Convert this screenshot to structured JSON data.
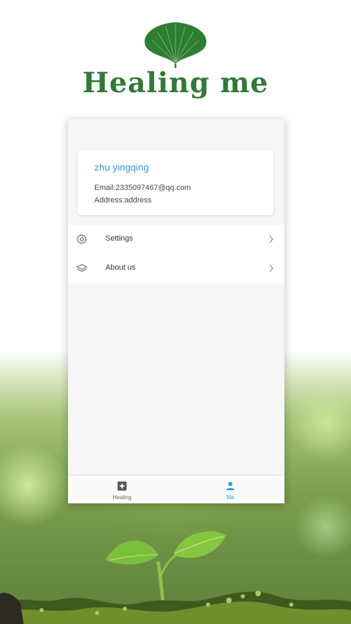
{
  "app": {
    "title": "Healing me",
    "brand_color": "#2f7a36",
    "accent_color": "#2b9ce6"
  },
  "profile": {
    "name": "zhu yingqing",
    "email": "Email:2335097467@qq.com",
    "address": "Address:address"
  },
  "menu": {
    "items": [
      {
        "label": "Settings",
        "icon": "gear-icon"
      },
      {
        "label": "About us",
        "icon": "layers-icon"
      }
    ]
  },
  "tabbar": {
    "tabs": [
      {
        "label": "Healing",
        "icon": "plus-box-icon",
        "active": false
      },
      {
        "label": "Me",
        "icon": "person-icon",
        "active": true
      }
    ]
  }
}
